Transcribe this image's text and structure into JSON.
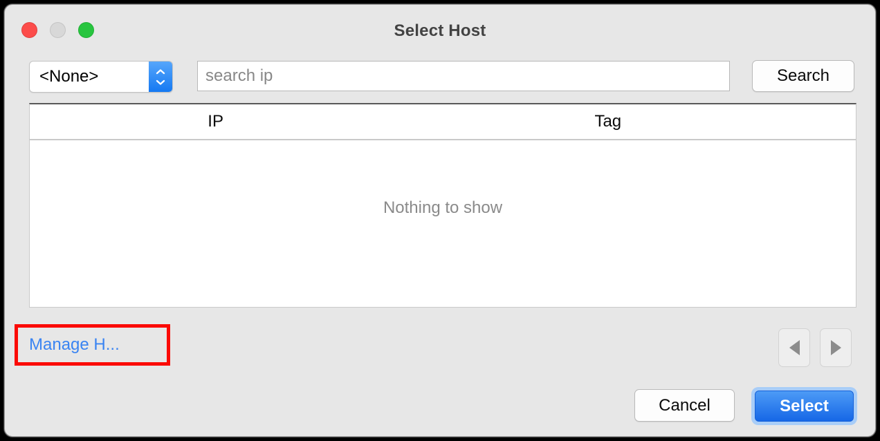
{
  "window": {
    "title": "Select Host",
    "traffic_lights": [
      {
        "name": "close",
        "color": "#fc4c4a"
      },
      {
        "name": "minimize",
        "color": "#d8d8d8"
      },
      {
        "name": "zoom",
        "color": "#28c53f"
      }
    ]
  },
  "toolbar": {
    "host_select": {
      "selected": "<None>",
      "options": [
        "<None>"
      ]
    },
    "search": {
      "value": "",
      "placeholder": "search ip"
    },
    "search_button_label": "Search"
  },
  "table": {
    "columns": [
      "IP",
      "Tag"
    ],
    "rows": [],
    "empty_message": "Nothing to show"
  },
  "footer": {
    "manage_link_label": "Manage H...",
    "prev_label": "",
    "next_label": "",
    "cancel_label": "Cancel",
    "select_label": "Select"
  },
  "annotation": {
    "color": "#fb0a05",
    "target": "manage-hosts-link"
  }
}
